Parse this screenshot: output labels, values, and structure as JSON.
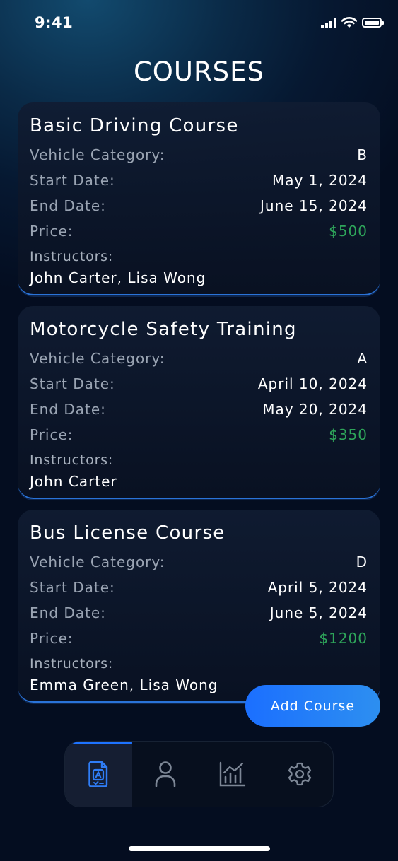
{
  "status_bar": {
    "time": "9:41"
  },
  "page": {
    "title": "COURSES"
  },
  "labels": {
    "vehicle_category": "Vehicle Category:",
    "start_date": "Start Date:",
    "end_date": "End Date:",
    "price": "Price:",
    "instructors": "Instructors:"
  },
  "courses": [
    {
      "title": "Basic Driving Course",
      "vehicle_category": "B",
      "start_date": "May 1, 2024",
      "end_date": "June 15, 2024",
      "price": "$500",
      "instructors": "John Carter, Lisa Wong"
    },
    {
      "title": "Motorcycle Safety Training",
      "vehicle_category": "A",
      "start_date": "April 10, 2024",
      "end_date": "May 20, 2024",
      "price": "$350",
      "instructors": "John Carter"
    },
    {
      "title": "Bus License Course",
      "vehicle_category": "D",
      "start_date": "April 5, 2024",
      "end_date": "June 5, 2024",
      "price": "$1200",
      "instructors": "Emma Green, Lisa Wong"
    }
  ],
  "actions": {
    "add_course": "Add Course"
  },
  "tab_bar": {
    "items": [
      {
        "icon": "license-icon",
        "active": true
      },
      {
        "icon": "user-icon",
        "active": false
      },
      {
        "icon": "chart-icon",
        "active": false
      },
      {
        "icon": "gear-icon",
        "active": false
      }
    ]
  },
  "colors": {
    "accent": "#1e73ff",
    "price": "#2ea55a",
    "label": "#9aa4b3"
  }
}
